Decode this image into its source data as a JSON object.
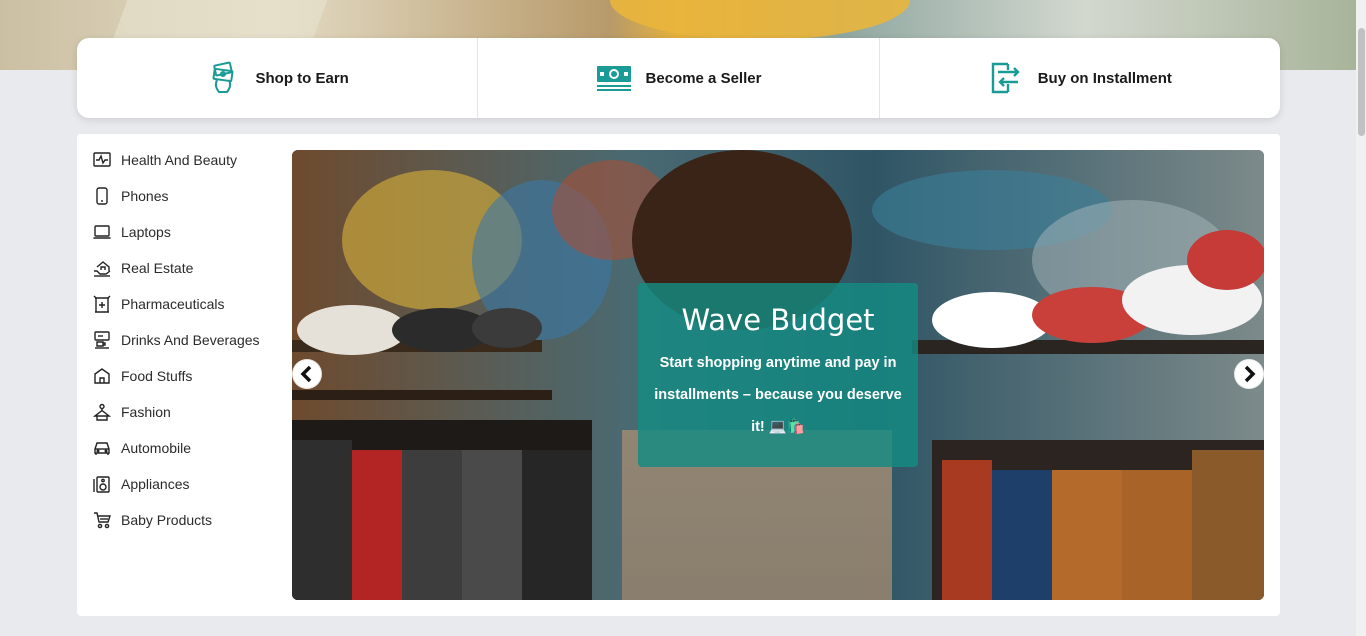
{
  "features": [
    {
      "label": "Shop to Earn",
      "icon": "money-bundle-icon"
    },
    {
      "label": "Become a Seller",
      "icon": "cash-stack-icon"
    },
    {
      "label": "Buy on Installment",
      "icon": "transfer-arrow-icon"
    }
  ],
  "categories": [
    {
      "label": "Health And Beauty",
      "icon": "pulse-icon"
    },
    {
      "label": "Phones",
      "icon": "phone-icon"
    },
    {
      "label": "Laptops",
      "icon": "laptop-icon"
    },
    {
      "label": "Real Estate",
      "icon": "house-hand-icon"
    },
    {
      "label": "Pharmaceuticals",
      "icon": "pharmacy-icon"
    },
    {
      "label": "Drinks And Beverages",
      "icon": "coffee-machine-icon"
    },
    {
      "label": "Food Stuffs",
      "icon": "store-icon"
    },
    {
      "label": "Fashion",
      "icon": "hanger-icon"
    },
    {
      "label": "Automobile",
      "icon": "car-icon"
    },
    {
      "label": "Appliances",
      "icon": "speaker-icon"
    },
    {
      "label": "Baby Products",
      "icon": "stroller-icon"
    }
  ],
  "hero": {
    "title": "Wave Budget",
    "text": "Start shopping anytime and pay in installments – because you deserve it! 💻🛍️",
    "prev_icon": "chevron-left-icon",
    "next_icon": "chevron-right-icon"
  },
  "colors": {
    "accent": "#1a9b96",
    "card_overlay": "#158b82"
  }
}
